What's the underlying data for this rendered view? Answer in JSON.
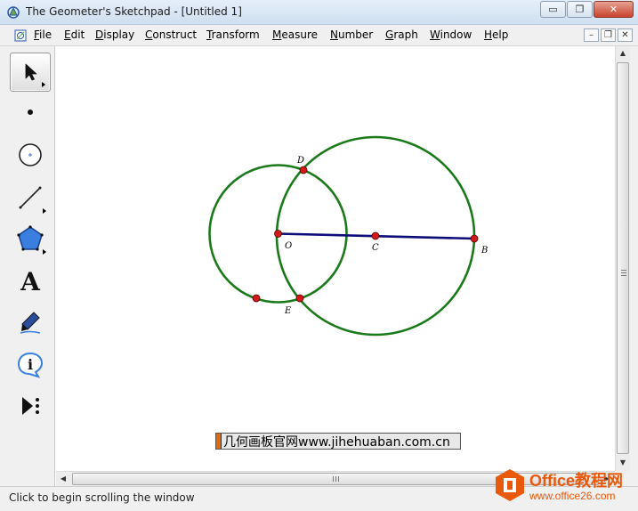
{
  "window": {
    "title": "The Geometer's Sketchpad - [Untitled 1]",
    "minimize_glyph": "▭",
    "maximize_glyph": "❐",
    "close_glyph": "✕"
  },
  "menu": {
    "items": [
      "File",
      "Edit",
      "Display",
      "Construct",
      "Transform",
      "Measure",
      "Number",
      "Graph",
      "Window",
      "Help"
    ],
    "mdi_minimize": "–",
    "mdi_restore": "❐",
    "mdi_close": "✕"
  },
  "toolbox": {
    "tools": [
      {
        "name": "arrow-tool",
        "icon": "arrow-icon",
        "selected": true
      },
      {
        "name": "point-tool",
        "icon": "point-icon"
      },
      {
        "name": "compass-tool",
        "icon": "circle-icon"
      },
      {
        "name": "straightedge-tool",
        "icon": "line-icon"
      },
      {
        "name": "polygon-tool",
        "icon": "polygon-icon"
      },
      {
        "name": "text-tool",
        "icon": "text-a-icon",
        "glyph": "A"
      },
      {
        "name": "marker-tool",
        "icon": "marker-icon"
      },
      {
        "name": "information-tool",
        "icon": "info-icon",
        "glyph": "i"
      },
      {
        "name": "custom-tool",
        "icon": "custom-tool-icon"
      }
    ]
  },
  "sketch": {
    "circle_color": "#1a7a1a",
    "segment_color": "#0d0d7a",
    "point_color": "#d11a1a",
    "labels": {
      "D": "D",
      "O": "O",
      "C": "C",
      "B": "B",
      "E": "E"
    }
  },
  "watermark": {
    "text": "几何画板官网www.jihehuaban.com.cn"
  },
  "scrollbars": {
    "up_glyph": "▲",
    "down_glyph": "▼",
    "left_glyph": "◀",
    "right_glyph": "▶"
  },
  "status": {
    "text": "Click to begin scrolling the window"
  },
  "logo": {
    "brand": "Office教程网",
    "url": "www.office26.com",
    "color": "#e8590c"
  }
}
